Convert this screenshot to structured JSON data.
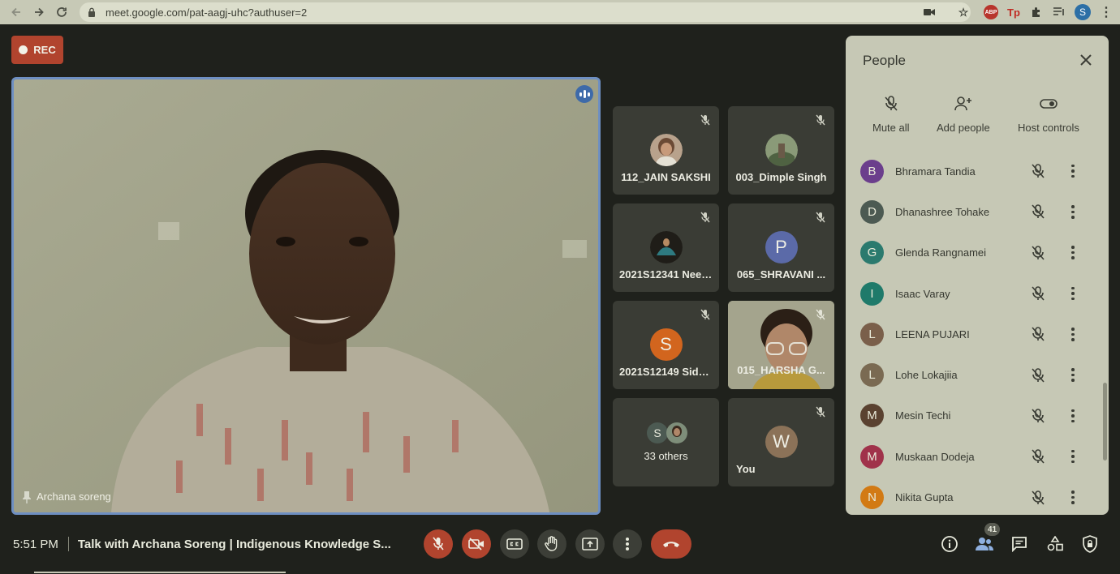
{
  "browser": {
    "url": "meet.google.com/pat-aagj-uhc?authuser=2",
    "ext_abp": "ABP",
    "ext_tp": "Tp",
    "profile_initial": "S"
  },
  "rec_label": "REC",
  "main_speaker": {
    "name": "Archana soreng"
  },
  "tiles": [
    {
      "name": "112_JAIN SAKSHI"
    },
    {
      "name": "003_Dimple Singh"
    },
    {
      "name": "2021S12341 Neel..."
    },
    {
      "name": "065_SHRAVANI ...",
      "initial": "P",
      "color": "#5b6aa8"
    },
    {
      "name": "2021S12149 Sidd...",
      "initial": "S",
      "color": "#d2651e"
    },
    {
      "name": "015_HARSHA G..."
    },
    {
      "name": "33 others",
      "initial": "S"
    },
    {
      "name": "You",
      "initial": "W",
      "color": "#8b7258"
    }
  ],
  "panel": {
    "title": "People",
    "actions": {
      "mute_all": "Mute all",
      "add_people": "Add people",
      "host_controls": "Host controls"
    },
    "people": [
      {
        "initial": "B",
        "name": "Bhramara Tandia",
        "color": "#6b3e8c"
      },
      {
        "initial": "D",
        "name": "Dhanashree Tohake",
        "color": "#4c5a52"
      },
      {
        "initial": "G",
        "name": "Glenda Rangnamei",
        "color": "#2b7a6e"
      },
      {
        "initial": "I",
        "name": "Isaac Varay",
        "color": "#1f7a6a"
      },
      {
        "initial": "L",
        "name": "LEENA PUJARI",
        "color": "#7a5f4a"
      },
      {
        "initial": "L",
        "name": "Lohe Lokajiia",
        "color": "#7a6a52"
      },
      {
        "initial": "M",
        "name": "Mesin Techi",
        "color": "#5a4230"
      },
      {
        "initial": "M",
        "name": "Muskaan Dodeja",
        "color": "#a0324a"
      },
      {
        "initial": "N",
        "name": "Nikita Gupta",
        "color": "#d27a14"
      }
    ]
  },
  "bottom": {
    "time": "5:51 PM",
    "meeting_title": "Talk with Archana Soreng | Indigenous Knowledge S...",
    "participant_count": "41"
  }
}
